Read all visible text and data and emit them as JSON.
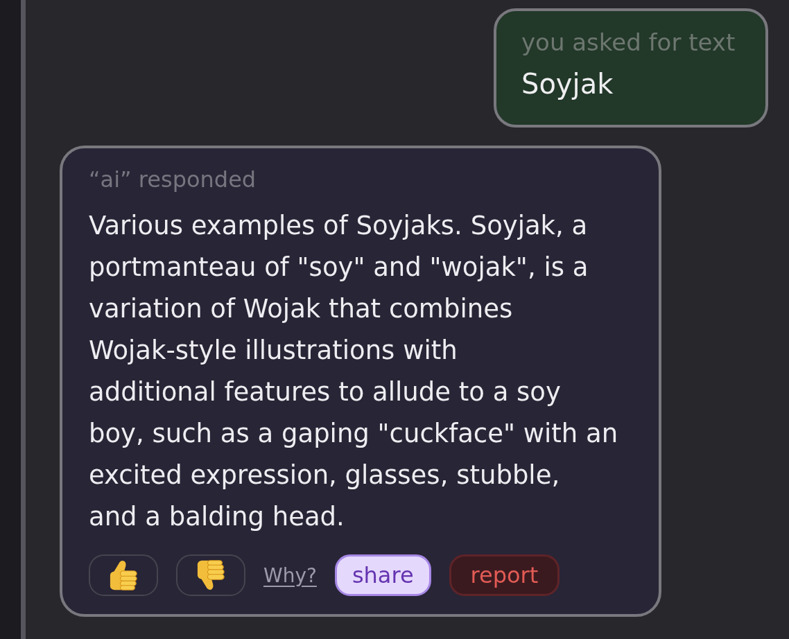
{
  "user_message": {
    "label": "you asked for text",
    "text": "Soyjak"
  },
  "ai_message": {
    "label": "“ai” responded",
    "text": "Various examples of Soyjaks. Soyjak, a\nportmanteau of \"soy\" and \"wojak\", is a\nvariation of Wojak that combines\nWojak-style illustrations with\nadditional features to allude to a soy\nboy, such as a gaping \"cuckface\" with an\nexcited expression, glasses, stubble,\nand a balding head.",
    "actions": [
      {
        "kind": "like"
      },
      {
        "kind": "dislike"
      },
      {
        "kind": "link",
        "label": "Why?"
      },
      {
        "kind": "share",
        "label": "share"
      },
      {
        "kind": "report",
        "label": "report"
      }
    ]
  }
}
